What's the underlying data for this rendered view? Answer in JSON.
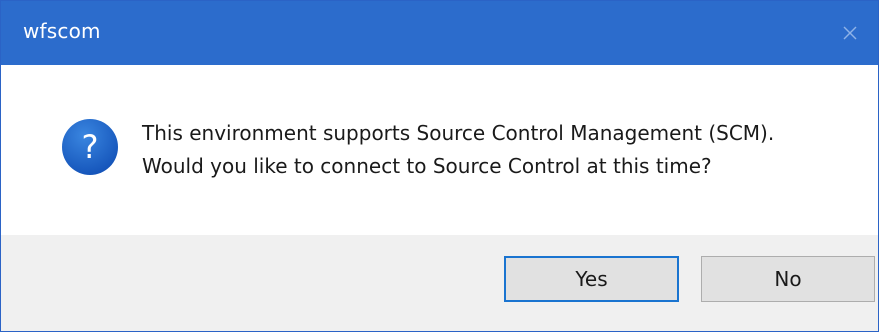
{
  "window": {
    "title": "wfscom",
    "close_symbol": "×"
  },
  "message": {
    "line1": "This environment supports Source Control Management (SCM).",
    "line2": "Would you like to connect to Source Control at this time?",
    "icon": "question-icon"
  },
  "buttons": {
    "yes_label": "Yes",
    "no_label": "No",
    "default": "Yes"
  },
  "colors": {
    "titlebar": "#2c6ccc",
    "icon_blue": "#1c62c7",
    "focus_border": "#1a74d0",
    "footer": "#f0f0f0"
  }
}
